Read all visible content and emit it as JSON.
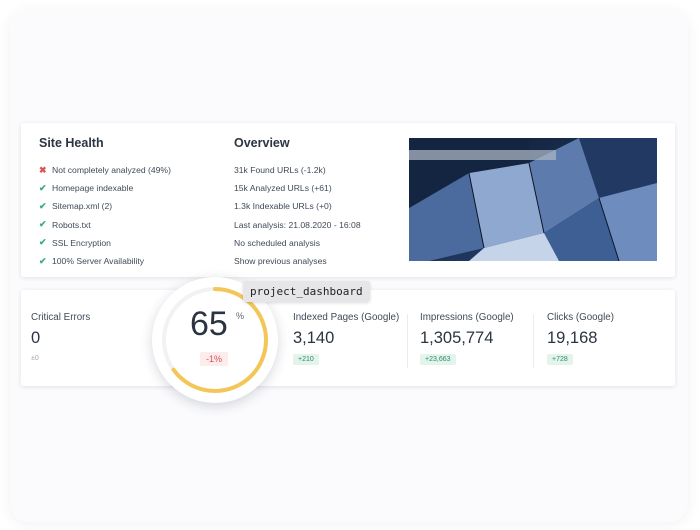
{
  "site_health": {
    "title": "Site Health",
    "items": [
      {
        "status": "error",
        "icon": "cross-icon",
        "label": "Not completely analyzed (49%)"
      },
      {
        "status": "ok",
        "icon": "check-icon",
        "label": "Homepage indexable"
      },
      {
        "status": "ok",
        "icon": "check-icon",
        "label": "Sitemap.xml (2)"
      },
      {
        "status": "ok",
        "icon": "check-icon",
        "label": "Robots.txt"
      },
      {
        "status": "ok",
        "icon": "check-icon",
        "label": "SSL Encryption"
      },
      {
        "status": "ok",
        "icon": "check-icon",
        "label": "100% Server Availability"
      }
    ]
  },
  "overview": {
    "title": "Overview",
    "items": [
      "31k Found URLs (-1.2k)",
      "15k Analyzed URLs (+61)",
      "1.3k Indexable URLs (+0)",
      "Last analysis: 21.08.2020 - 16:08",
      "No scheduled analysis",
      "Show previous analyses"
    ]
  },
  "score": {
    "value": "65",
    "unit": "%",
    "delta": "-1%",
    "fraction": 0.65,
    "color": "#f4c658"
  },
  "tooltip": "project_dashboard",
  "metrics": {
    "critical": {
      "label": "Critical Errors",
      "value": "0",
      "delta": "±0"
    },
    "indexed": {
      "label": "Indexed Pages (Google)",
      "value": "3,140",
      "delta": "+210"
    },
    "impressions": {
      "label": "Impressions (Google)",
      "value": "1,305,774",
      "delta": "+23,663"
    },
    "clicks": {
      "label": "Clicks (Google)",
      "value": "19,168",
      "delta": "+728"
    }
  },
  "colors": {
    "ok": "#3aa989",
    "error": "#d9534f",
    "gauge": "#f4c658"
  }
}
